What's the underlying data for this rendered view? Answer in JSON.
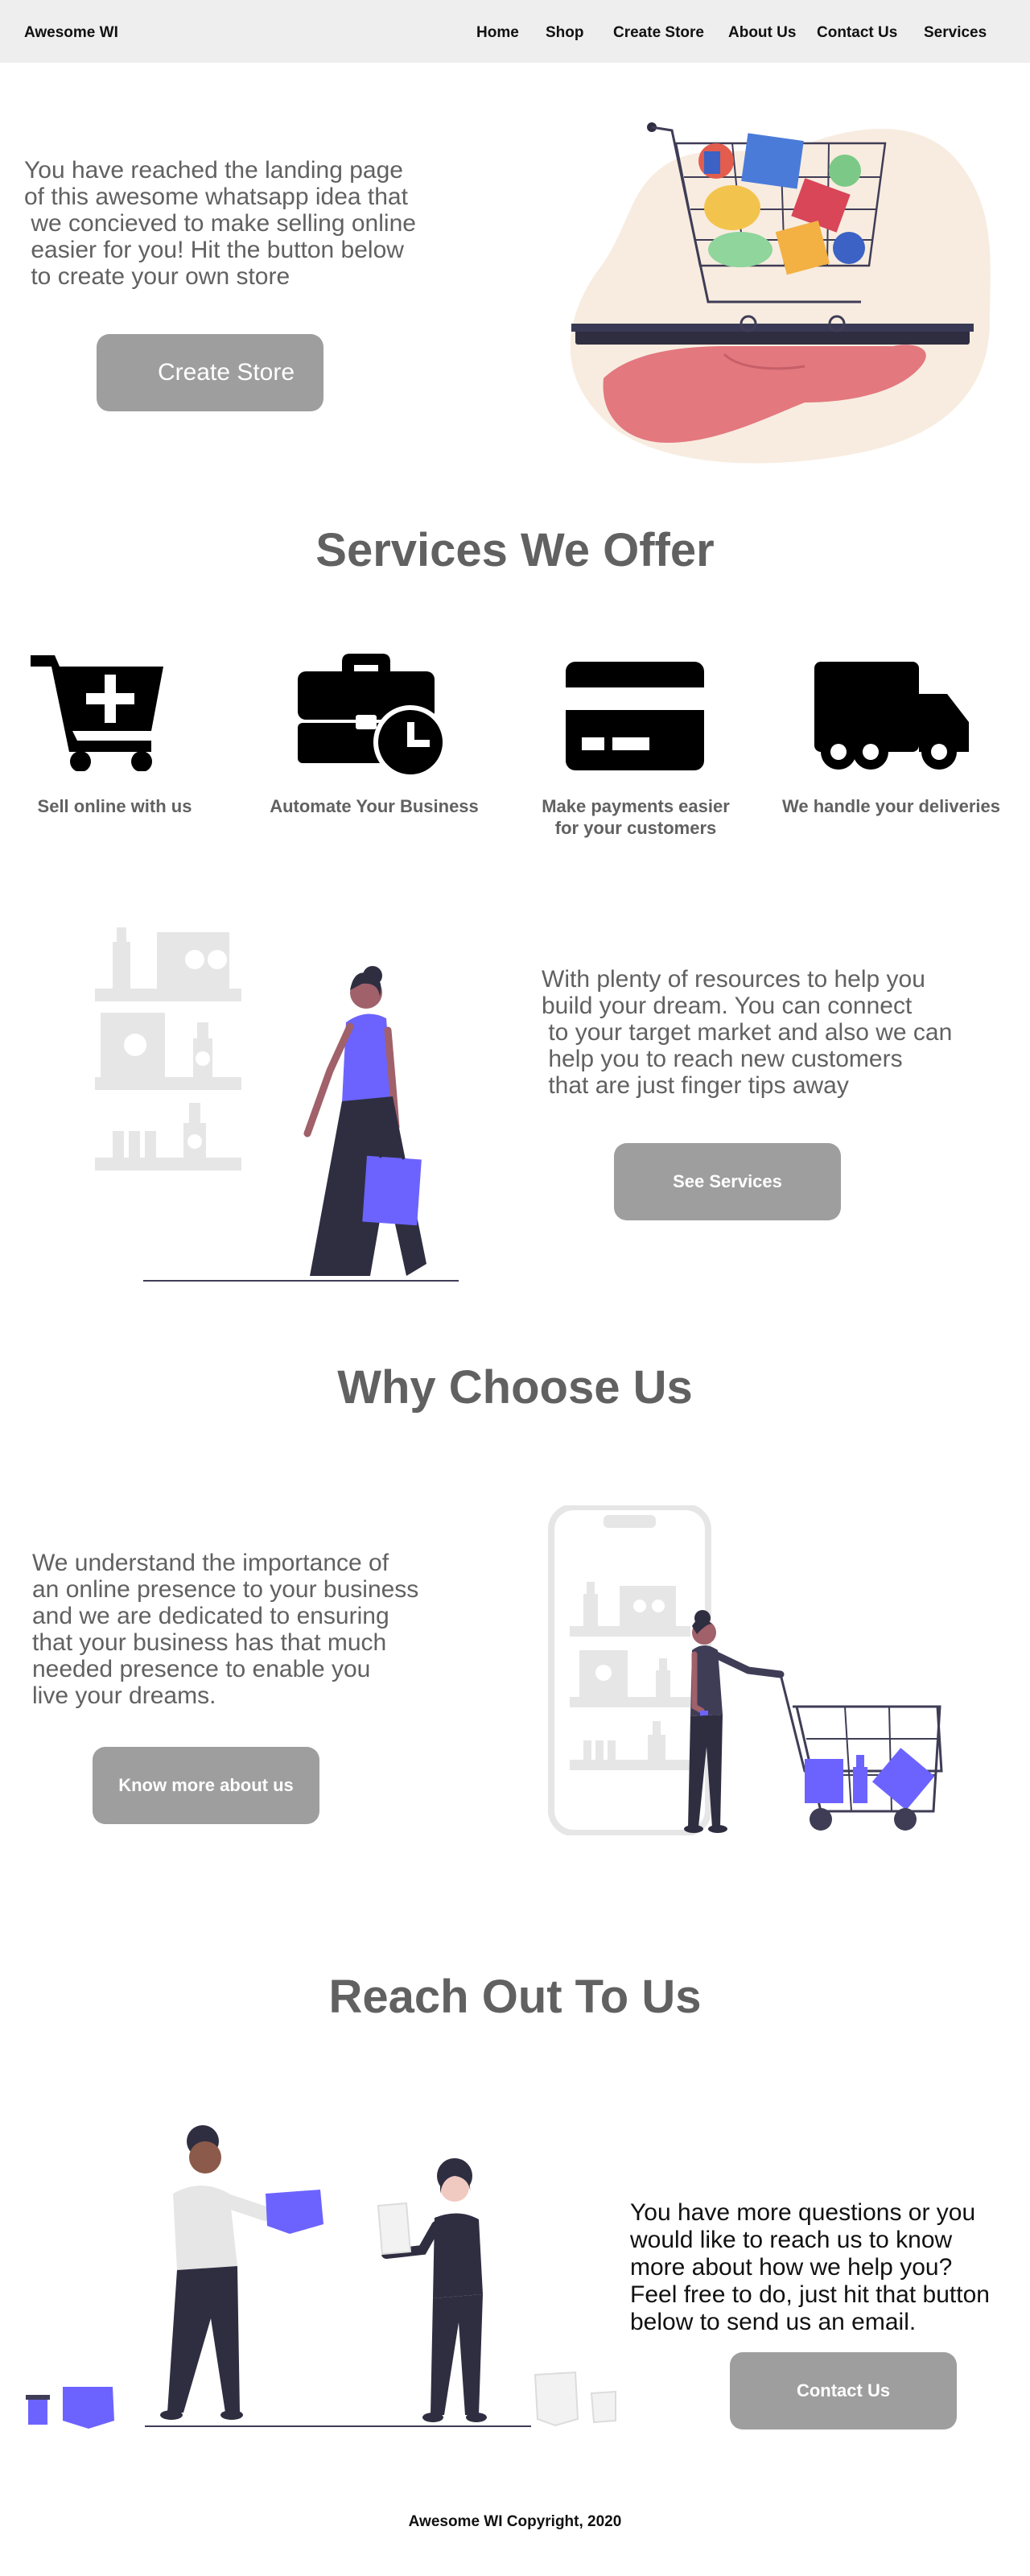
{
  "nav": {
    "brand": "Awesome WI",
    "links": [
      "Home",
      "Shop",
      "Create Store",
      "About Us",
      "Contact Us",
      "Services"
    ]
  },
  "hero": {
    "lines": [
      "You have reached the landing page",
      "of this awesome whatsapp idea that",
      " we concieved to make selling online",
      " easier for you! Hit the button below",
      " to create your own store"
    ],
    "button": "Create Store"
  },
  "services": {
    "title": "Services We Offer",
    "items": [
      {
        "label": "Sell online with us",
        "icon": "cart-plus-icon"
      },
      {
        "label": "Automate Your Business",
        "icon": "briefcase-clock-icon"
      },
      {
        "label": "Make payments easier\nfor your customers",
        "icon": "credit-card-icon"
      },
      {
        "label": "We handle your deliveries",
        "icon": "truck-icon"
      }
    ],
    "body_lines": [
      "With plenty of resources to help you",
      "build your dream. You can connect",
      " to your target market and also we can",
      " help you to reach new customers",
      " that are just finger tips away"
    ],
    "button": "See Services"
  },
  "why": {
    "title": "Why Choose Us",
    "lines": [
      "We understand the importance of",
      "an online presence to your business",
      "and we are dedicated to ensuring",
      "that your business has that much",
      "needed presence to enable you",
      "live your dreams."
    ],
    "button": "Know more about us"
  },
  "reach": {
    "title": "Reach Out To Us",
    "lines": [
      "You have more questions or you",
      "would like to reach us to know",
      "more about how we help you?",
      "Feel free to do, just hit that button",
      "below to send us an email."
    ],
    "button": "Contact Us"
  },
  "footer": "Awesome WI Copyright, 2020",
  "colors": {
    "accent_purple": "#6c63ff",
    "button_gray": "#9e9e9e",
    "text_gray": "#616161",
    "nav_bg": "#eeeeee",
    "dark_figure": "#2f2e41"
  }
}
